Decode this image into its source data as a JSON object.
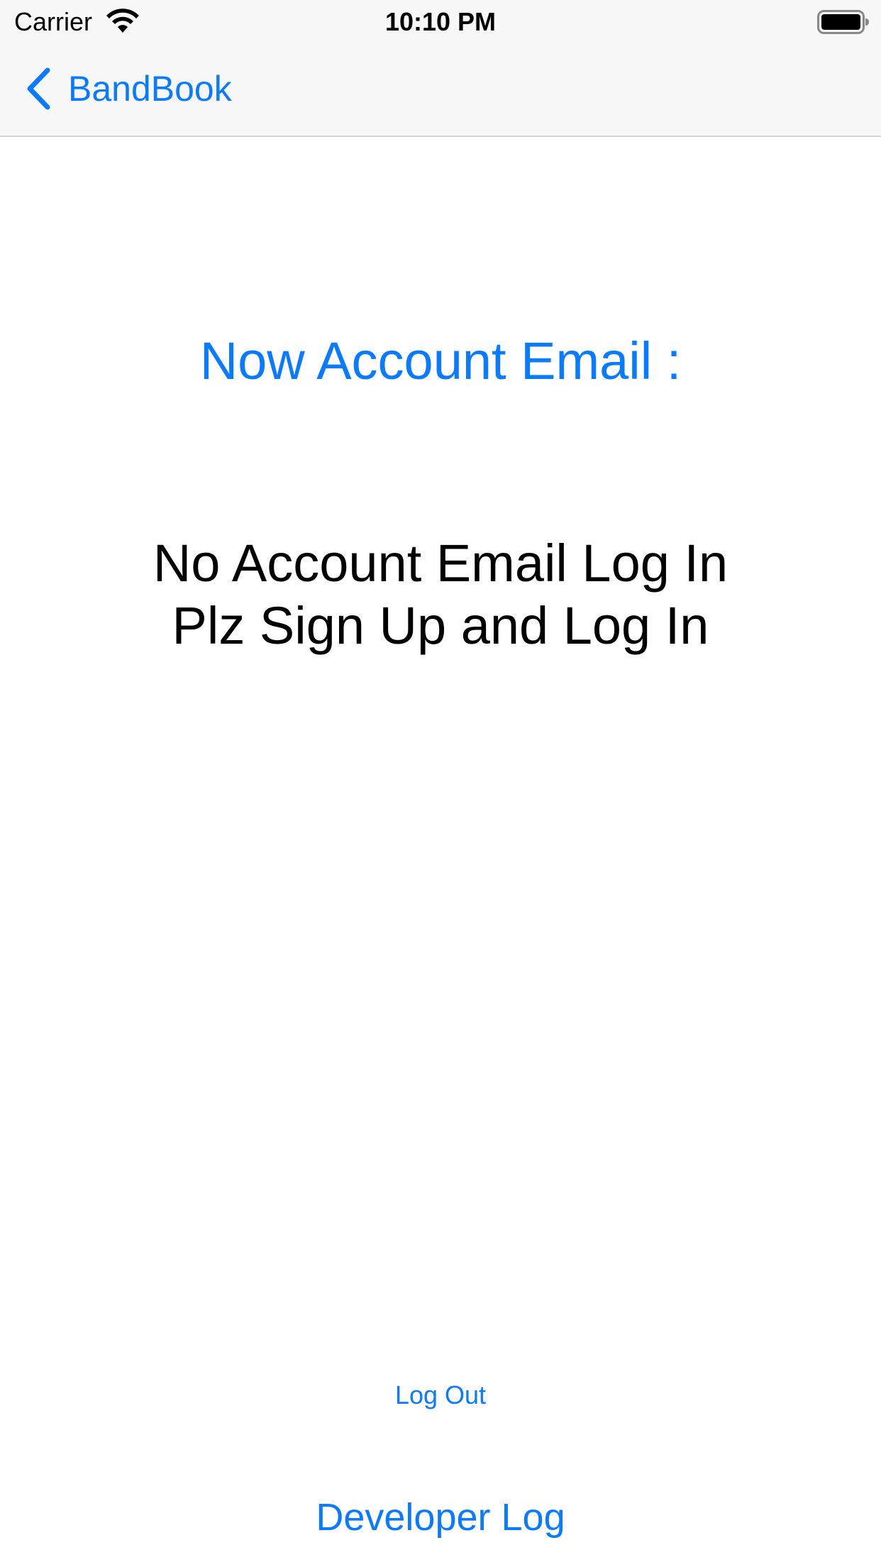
{
  "status_bar": {
    "carrier": "Carrier",
    "time": "10:10 PM",
    "wifi_icon": "wifi-icon",
    "battery_icon": "battery-icon"
  },
  "nav_bar": {
    "back_label": "BandBook",
    "back_icon": "chevron-left-icon"
  },
  "main": {
    "account_email_title": "Now Account Email :",
    "message_lines": [
      "No Account Email Log In",
      "Plz Sign Up and Log In"
    ]
  },
  "actions": {
    "logout_label": "Log Out",
    "developer_log_label": "Developer Log"
  },
  "colors": {
    "accent": "#0a7aff",
    "chrome_bg": "#f7f7f7",
    "text": "#000000"
  }
}
